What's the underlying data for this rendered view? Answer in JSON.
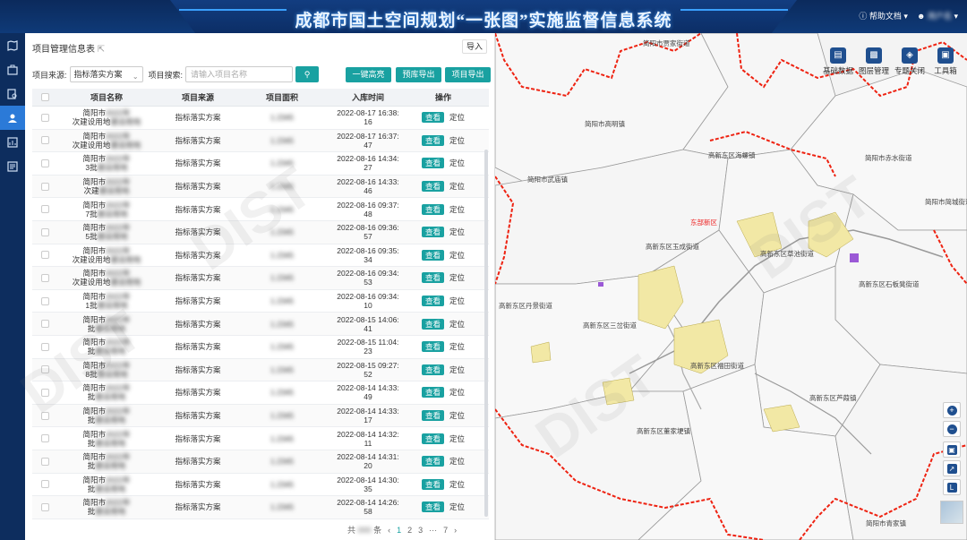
{
  "header": {
    "title": "成都市国土空间规划“一张图”实施监督信息系统",
    "help": "帮助文档",
    "help_arrow": "▾",
    "user_arrow": "▾"
  },
  "leftnav": {
    "icons": [
      "map-icon",
      "briefcase-icon",
      "document-search-icon",
      "user-project-icon",
      "chart-icon",
      "report-icon"
    ]
  },
  "panel": {
    "title": "项目管理信息表",
    "import": "导入",
    "filter_source_label": "项目来源:",
    "filter_source_value": "指标落实方案",
    "filter_search_label": "项目搜索:",
    "search_placeholder": "请输入项目名称",
    "btn_one_key": "一键高亮",
    "btn_export_lib": "预库导出",
    "btn_export_project": "项目导出"
  },
  "table": {
    "headers": [
      "项目名称",
      "项目来源",
      "项目面积",
      "入库时间",
      "操作"
    ],
    "view_label": "查看",
    "locate_label": "定位",
    "rows": [
      {
        "name1": "简阳市",
        "name2": "次建设用地",
        "source": "指标落实方案",
        "time1": "2022-08-17 16:38:",
        "time2": "16"
      },
      {
        "name1": "简阳市",
        "name2": "次建设用地",
        "source": "指标落实方案",
        "time1": "2022-08-17 16:37:",
        "time2": "47"
      },
      {
        "name1": "简阳市",
        "name2": "3批",
        "source": "指标落实方案",
        "time1": "2022-08-16 14:34:",
        "time2": "27"
      },
      {
        "name1": "简阳市",
        "name2": "次建",
        "source": "指标落实方案",
        "time1": "2022-08-16 14:33:",
        "time2": "46"
      },
      {
        "name1": "简阳市",
        "name2": "7批",
        "source": "指标落实方案",
        "time1": "2022-08-16 09:37:",
        "time2": "48"
      },
      {
        "name1": "简阳市",
        "name2": "5批",
        "source": "指标落实方案",
        "time1": "2022-08-16 09:36:",
        "time2": "57"
      },
      {
        "name1": "简阳市",
        "name2": "次建设用地",
        "source": "指标落实方案",
        "time1": "2022-08-16 09:35:",
        "time2": "34"
      },
      {
        "name1": "简阳市",
        "name2": "次建设用地",
        "source": "指标落实方案",
        "time1": "2022-08-16 09:34:",
        "time2": "53"
      },
      {
        "name1": "简阳市",
        "name2": "1批",
        "source": "指标落实方案",
        "time1": "2022-08-16 09:34:",
        "time2": "10"
      },
      {
        "name1": "简阳市",
        "name2": "批",
        "source": "指标落实方案",
        "time1": "2022-08-15 14:06:",
        "time2": "41"
      },
      {
        "name1": "简阳市",
        "name2": "批",
        "source": "指标落实方案",
        "time1": "2022-08-15 11:04:",
        "time2": "23"
      },
      {
        "name1": "简阳市",
        "name2": "8批",
        "source": "指标落实方案",
        "time1": "2022-08-15 09:27:",
        "time2": "52"
      },
      {
        "name1": "简阳市",
        "name2": "批",
        "source": "指标落实方案",
        "time1": "2022-08-14 14:33:",
        "time2": "49"
      },
      {
        "name1": "简阳市",
        "name2": "批",
        "source": "指标落实方案",
        "time1": "2022-08-14 14:33:",
        "time2": "17"
      },
      {
        "name1": "简阳市",
        "name2": "批",
        "source": "指标落实方案",
        "time1": "2022-08-14 14:32:",
        "time2": "11"
      },
      {
        "name1": "简阳市",
        "name2": "批",
        "source": "指标落实方案",
        "time1": "2022-08-14 14:31:",
        "time2": "20"
      },
      {
        "name1": "简阳市",
        "name2": "批",
        "source": "指标落实方案",
        "time1": "2022-08-14 14:30:",
        "time2": "35"
      },
      {
        "name1": "简阳市",
        "name2": "批",
        "source": "指标落实方案",
        "time1": "2022-08-14 14:26:",
        "time2": "58"
      }
    ]
  },
  "pager": {
    "total_prefix": "共",
    "total_suffix": "条",
    "pages": [
      "1",
      "2",
      "3",
      "···",
      "7"
    ],
    "current": "1",
    "prev": "‹",
    "next": "›"
  },
  "map": {
    "tools": [
      {
        "label": "基础数据",
        "icon": "layers-icon"
      },
      {
        "label": "图层管理",
        "icon": "layer-manage-icon"
      },
      {
        "label": "专题关闭",
        "icon": "topic-icon"
      },
      {
        "label": "工具箱",
        "icon": "toolbox-icon"
      }
    ],
    "labels": {
      "l1": "简阳市贾家街道",
      "l2": "简阳市高明镇",
      "l3": "高新东区海螺镇",
      "l4": "简阳市赤水街道",
      "l5": "简阳市武庙镇",
      "l6": "简阳市简城街道",
      "l7": "东部新区",
      "l8": "高新东区玉成街道",
      "l9": "高新东区草池街道",
      "l10": "高新东区丹景街道",
      "l11": "高新东区石板凳街道",
      "l12": "高新东区三岔街道",
      "l13": "高新东区福田街道",
      "l14": "高新东区芦葭镇",
      "l15": "高新东区董家埂镇",
      "l16": "简阳市青家镇"
    }
  },
  "watermark": "DIST"
}
